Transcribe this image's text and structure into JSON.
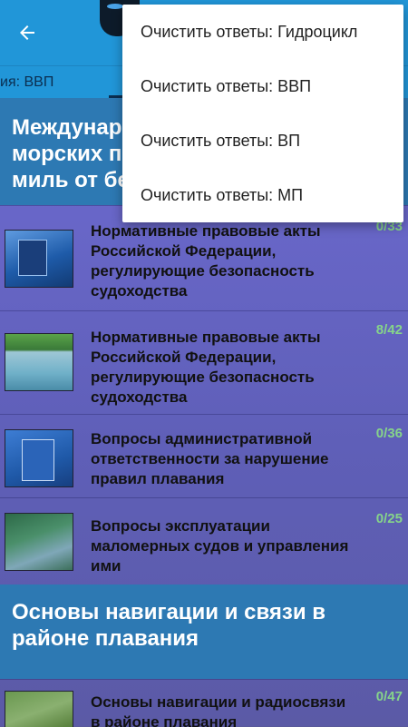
{
  "tabs": {
    "visible_label": "ия: ВВП"
  },
  "menu": {
    "items": [
      {
        "label": "Очистить ответы: Гидроцикл"
      },
      {
        "label": "Очистить ответы: ВВП"
      },
      {
        "label": "Очистить ответы: ВП"
      },
      {
        "label": "Очистить ответы: МП"
      }
    ]
  },
  "sections": [
    {
      "title": "Междунар... морских п... миль от бе...",
      "title_lines": [
        "Междунар",
        "морских п",
        "миль от бе"
      ]
    },
    {
      "title": "Основы навигации и связи в районе плавания",
      "title_lines": [
        "Основы навигации и связи в",
        "районе плавания"
      ]
    }
  ],
  "items": [
    {
      "thumb_icon": "water-code-book-icon",
      "label": "Нормативные правовые акты Российской Федерации, регулирующие безопасность судоходства",
      "count": "0/33"
    },
    {
      "thumb_icon": "coast-boat-photo-icon",
      "label": "Нормативные правовые акты Российской Федерации, регулирующие безопасность судоходства",
      "count": "8/42"
    },
    {
      "thumb_icon": "admin-code-book-icon",
      "label": "Вопросы административной ответственности за нарушение правил плавания",
      "count": "0/36"
    },
    {
      "thumb_icon": "river-boat-photo-icon",
      "label": "Вопросы эксплуатации маломерных судов и управления ими",
      "count": "0/25"
    },
    {
      "thumb_icon": "nautical-map-icon",
      "label": "Основы навигации и радиосвязи в районе плавания",
      "count": "0/47"
    }
  ],
  "colors": {
    "appbar": "#2196d8",
    "section_header": "#2d79b3",
    "count": "#86d48a",
    "menu_bg": "#ffffff"
  }
}
